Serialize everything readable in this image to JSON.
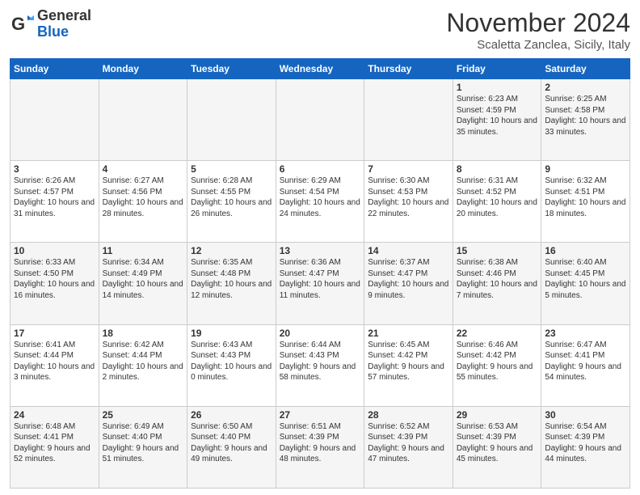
{
  "logo": {
    "general": "General",
    "blue": "Blue"
  },
  "title": "November 2024",
  "location": "Scaletta Zanclea, Sicily, Italy",
  "days_of_week": [
    "Sunday",
    "Monday",
    "Tuesday",
    "Wednesday",
    "Thursday",
    "Friday",
    "Saturday"
  ],
  "weeks": [
    [
      {
        "day": "",
        "info": ""
      },
      {
        "day": "",
        "info": ""
      },
      {
        "day": "",
        "info": ""
      },
      {
        "day": "",
        "info": ""
      },
      {
        "day": "",
        "info": ""
      },
      {
        "day": "1",
        "info": "Sunrise: 6:23 AM\nSunset: 4:59 PM\nDaylight: 10 hours and 35 minutes."
      },
      {
        "day": "2",
        "info": "Sunrise: 6:25 AM\nSunset: 4:58 PM\nDaylight: 10 hours and 33 minutes."
      }
    ],
    [
      {
        "day": "3",
        "info": "Sunrise: 6:26 AM\nSunset: 4:57 PM\nDaylight: 10 hours and 31 minutes."
      },
      {
        "day": "4",
        "info": "Sunrise: 6:27 AM\nSunset: 4:56 PM\nDaylight: 10 hours and 28 minutes."
      },
      {
        "day": "5",
        "info": "Sunrise: 6:28 AM\nSunset: 4:55 PM\nDaylight: 10 hours and 26 minutes."
      },
      {
        "day": "6",
        "info": "Sunrise: 6:29 AM\nSunset: 4:54 PM\nDaylight: 10 hours and 24 minutes."
      },
      {
        "day": "7",
        "info": "Sunrise: 6:30 AM\nSunset: 4:53 PM\nDaylight: 10 hours and 22 minutes."
      },
      {
        "day": "8",
        "info": "Sunrise: 6:31 AM\nSunset: 4:52 PM\nDaylight: 10 hours and 20 minutes."
      },
      {
        "day": "9",
        "info": "Sunrise: 6:32 AM\nSunset: 4:51 PM\nDaylight: 10 hours and 18 minutes."
      }
    ],
    [
      {
        "day": "10",
        "info": "Sunrise: 6:33 AM\nSunset: 4:50 PM\nDaylight: 10 hours and 16 minutes."
      },
      {
        "day": "11",
        "info": "Sunrise: 6:34 AM\nSunset: 4:49 PM\nDaylight: 10 hours and 14 minutes."
      },
      {
        "day": "12",
        "info": "Sunrise: 6:35 AM\nSunset: 4:48 PM\nDaylight: 10 hours and 12 minutes."
      },
      {
        "day": "13",
        "info": "Sunrise: 6:36 AM\nSunset: 4:47 PM\nDaylight: 10 hours and 11 minutes."
      },
      {
        "day": "14",
        "info": "Sunrise: 6:37 AM\nSunset: 4:47 PM\nDaylight: 10 hours and 9 minutes."
      },
      {
        "day": "15",
        "info": "Sunrise: 6:38 AM\nSunset: 4:46 PM\nDaylight: 10 hours and 7 minutes."
      },
      {
        "day": "16",
        "info": "Sunrise: 6:40 AM\nSunset: 4:45 PM\nDaylight: 10 hours and 5 minutes."
      }
    ],
    [
      {
        "day": "17",
        "info": "Sunrise: 6:41 AM\nSunset: 4:44 PM\nDaylight: 10 hours and 3 minutes."
      },
      {
        "day": "18",
        "info": "Sunrise: 6:42 AM\nSunset: 4:44 PM\nDaylight: 10 hours and 2 minutes."
      },
      {
        "day": "19",
        "info": "Sunrise: 6:43 AM\nSunset: 4:43 PM\nDaylight: 10 hours and 0 minutes."
      },
      {
        "day": "20",
        "info": "Sunrise: 6:44 AM\nSunset: 4:43 PM\nDaylight: 9 hours and 58 minutes."
      },
      {
        "day": "21",
        "info": "Sunrise: 6:45 AM\nSunset: 4:42 PM\nDaylight: 9 hours and 57 minutes."
      },
      {
        "day": "22",
        "info": "Sunrise: 6:46 AM\nSunset: 4:42 PM\nDaylight: 9 hours and 55 minutes."
      },
      {
        "day": "23",
        "info": "Sunrise: 6:47 AM\nSunset: 4:41 PM\nDaylight: 9 hours and 54 minutes."
      }
    ],
    [
      {
        "day": "24",
        "info": "Sunrise: 6:48 AM\nSunset: 4:41 PM\nDaylight: 9 hours and 52 minutes."
      },
      {
        "day": "25",
        "info": "Sunrise: 6:49 AM\nSunset: 4:40 PM\nDaylight: 9 hours and 51 minutes."
      },
      {
        "day": "26",
        "info": "Sunrise: 6:50 AM\nSunset: 4:40 PM\nDaylight: 9 hours and 49 minutes."
      },
      {
        "day": "27",
        "info": "Sunrise: 6:51 AM\nSunset: 4:39 PM\nDaylight: 9 hours and 48 minutes."
      },
      {
        "day": "28",
        "info": "Sunrise: 6:52 AM\nSunset: 4:39 PM\nDaylight: 9 hours and 47 minutes."
      },
      {
        "day": "29",
        "info": "Sunrise: 6:53 AM\nSunset: 4:39 PM\nDaylight: 9 hours and 45 minutes."
      },
      {
        "day": "30",
        "info": "Sunrise: 6:54 AM\nSunset: 4:39 PM\nDaylight: 9 hours and 44 minutes."
      }
    ]
  ]
}
